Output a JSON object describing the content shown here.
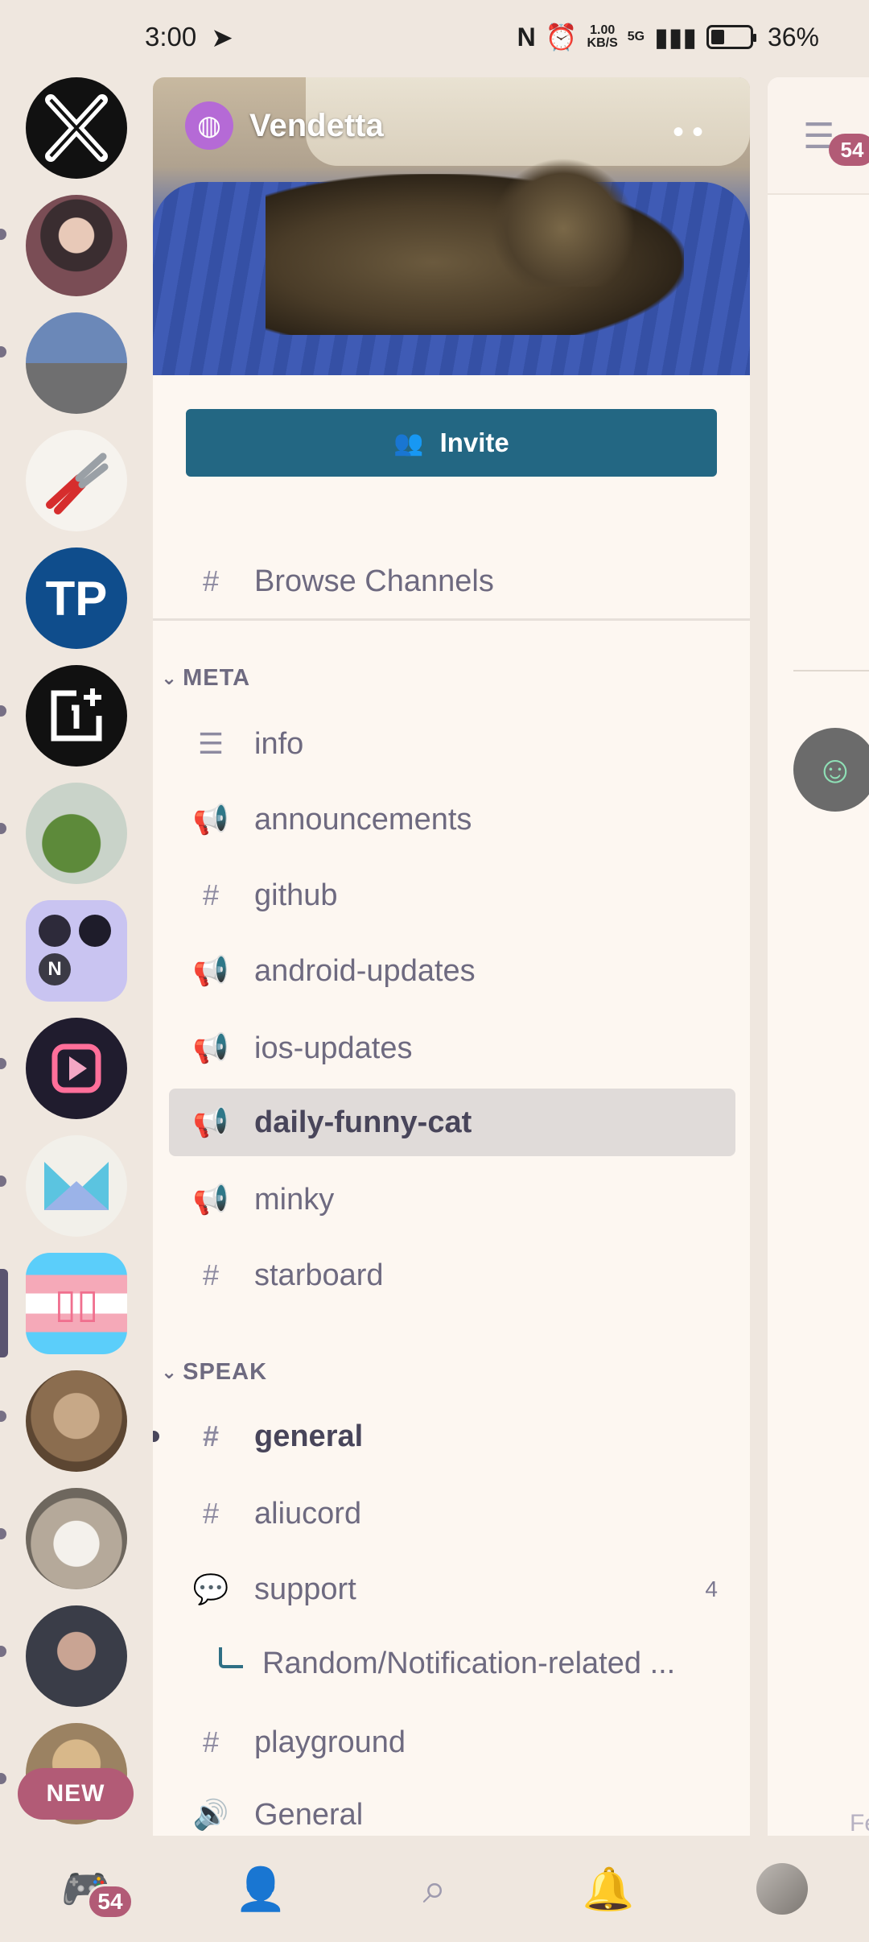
{
  "status_bar": {
    "time": "3:00",
    "net_speed_top": "1.00",
    "net_speed_bottom": "KB/S",
    "network": "5G",
    "battery": "36%"
  },
  "servers": [
    {
      "name": "X",
      "color": "#111111"
    },
    {
      "name": "avatar-anime",
      "color": "#7a6a6a"
    },
    {
      "name": "avatar-photo",
      "color": "#6a7fa0"
    },
    {
      "name": "pliers",
      "color": "#f6f3ee"
    },
    {
      "name": "TP",
      "color": "#0f4d8c"
    },
    {
      "name": "1+",
      "color": "#111111"
    },
    {
      "name": "pepe",
      "color": "#c9d3c9"
    },
    {
      "name": "folder",
      "color": "#c9c4f1"
    },
    {
      "name": "play",
      "color": "#201c2e"
    },
    {
      "name": "envelope",
      "color": "#f2f0ea"
    },
    {
      "name": "trans-flag",
      "color": "#5bcefa"
    },
    {
      "name": "cat",
      "color": "#8b6d4f"
    },
    {
      "name": "dog",
      "color": "#b5a99a"
    },
    {
      "name": "person",
      "color": "#4a4d5a"
    },
    {
      "name": "dog2",
      "color": "#9b8262"
    }
  ],
  "new_badge": "NEW",
  "server": {
    "name": "Vendetta",
    "invite_label": "Invite",
    "browse_label": "Browse Channels"
  },
  "categories": {
    "meta": "META",
    "speak": "SPEAK"
  },
  "meta_channels": [
    {
      "name": "info",
      "icon": "rules-icon"
    },
    {
      "name": "announcements",
      "icon": "megaphone-icon"
    },
    {
      "name": "github",
      "icon": "hash-icon"
    },
    {
      "name": "android-updates",
      "icon": "megaphone-icon"
    },
    {
      "name": "ios-updates",
      "icon": "megaphone-icon"
    },
    {
      "name": "daily-funny-cat",
      "icon": "megaphone-icon"
    },
    {
      "name": "minky",
      "icon": "megaphone-icon"
    },
    {
      "name": "starboard",
      "icon": "hash-icon"
    }
  ],
  "speak_channels": [
    {
      "name": "general",
      "icon": "hash-icon"
    },
    {
      "name": "aliucord",
      "icon": "locked-hash-icon"
    },
    {
      "name": "support",
      "icon": "forum-icon",
      "badge": "4"
    },
    {
      "name": "Random/Notification-related ...",
      "icon": "thread-icon"
    },
    {
      "name": "playground",
      "icon": "hash-icon"
    },
    {
      "name": "General",
      "icon": "voice-icon"
    }
  ],
  "right_panel": {
    "members_badge": "54",
    "cut_text": "Fe"
  },
  "bottom_nav": {
    "home_badge": "54"
  }
}
